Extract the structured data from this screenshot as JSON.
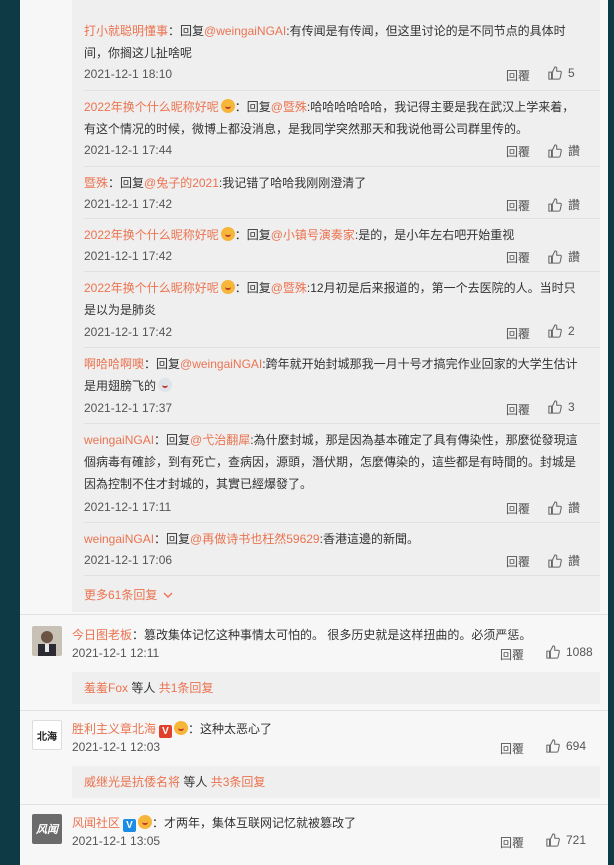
{
  "replies": [
    {
      "user": "打小就聪明懂事",
      "prefix": "：回复",
      "at": "@weingaiNGAI",
      "text": ":有传闻是有传闻，但这里讨论的是不同节点的具体时间，你搁这儿扯啥呢",
      "time": "2021-12-1 18:10",
      "reply_label": "回覆",
      "likes": "5"
    },
    {
      "user": "2022年换个什么昵称好呢",
      "prefix": "：回复",
      "at": "@暨殊",
      "text": ":哈哈哈哈哈哈，我记得主要是我在武汉上学来着，有这个情况的时候，微博上都没消息，是我同学突然那天和我说他哥公司群里传的。",
      "time": "2021-12-1 17:44",
      "reply_label": "回覆",
      "likes": "讚"
    },
    {
      "user": "暨殊",
      "prefix": "：回复",
      "at": "@兔子的2021",
      "text": ":我记错了哈哈我刚刚澄清了",
      "time": "2021-12-1 17:42",
      "reply_label": "回覆",
      "likes": "讚"
    },
    {
      "user": "2022年换个什么昵称好呢",
      "prefix": "：回复",
      "at": "@小镇号演奏家",
      "text": ":是的，是小年左右吧开始重视",
      "time": "2021-12-1 17:42",
      "reply_label": "回覆",
      "likes": "讚"
    },
    {
      "user": "2022年换个什么昵称好呢",
      "prefix": "：回复",
      "at": "@暨殊",
      "text": ":12月初是后来报道的，第一个去医院的人。当时只是以为是肺炎",
      "time": "2021-12-1 17:42",
      "reply_label": "回覆",
      "likes": "2"
    },
    {
      "user": "啊哈哈啊噢",
      "prefix": "：回复",
      "at": "@weingaiNGAI",
      "text": ":跨年就开始封城那我一月十号才搞完作业回家的大学生估计是用翅膀飞的",
      "time": "2021-12-1 17:37",
      "reply_label": "回覆",
      "likes": "3"
    },
    {
      "user": "weingaiNGAI",
      "prefix": "：回复",
      "at": "@弋治翻犀",
      "text": ":為什麼封城，那是因為基本確定了具有傳染性，那麼從發現這個病毒有確診，到有死亡，查病因，源頭，潛伏期，怎麼傳染的，這些都是有時間的。封城是因為控制不住才封城的，其實已經爆發了。",
      "time": "2021-12-1 17:11",
      "reply_label": "回覆",
      "likes": "讚"
    },
    {
      "user": "weingaiNGAI",
      "prefix": "：回复",
      "at": "@再做诗书也枉然59629",
      "text": ":香港這邊的新聞。",
      "time": "2021-12-1 17:06",
      "reply_label": "回覆",
      "likes": "讚"
    }
  ],
  "more_replies": "更多61条回复",
  "comments": [
    {
      "user": "今日图老板",
      "text": "：篡改集体记忆这种事情太可怕的。 很多历史就是这样扭曲的。必须严惩。",
      "time": "2021-12-1 12:11",
      "reply_label": "回覆",
      "likes": "1088",
      "sub": {
        "user": "羞羞Fox",
        "mid": " 等人 ",
        "count": "共1条回复"
      }
    },
    {
      "user": "胜利主义章北海",
      "text": "：这种太恶心了",
      "time": "2021-12-1 12:03",
      "reply_label": "回覆",
      "likes": "694",
      "avatar_text": "北海",
      "sub": {
        "user": "威继光是抗倭名将",
        "mid": " 等人 ",
        "count": "共3条回复"
      }
    },
    {
      "user": "风闻社区",
      "text": "：才两年，集体互联网记忆就被篡改了",
      "time": "2021-12-1 13:05",
      "reply_label": "回覆",
      "likes": "721",
      "avatar_text": "风闻"
    }
  ],
  "colors": {
    "accent": "#eb7350",
    "vip_red": "#e0412d",
    "verified_blue": "#1c8de6"
  }
}
